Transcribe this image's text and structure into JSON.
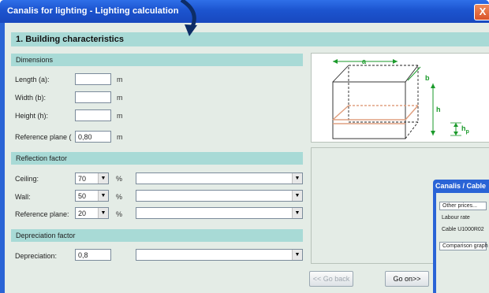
{
  "window": {
    "title": "Canalis for lighting - Lighting calculation",
    "close_label": "X"
  },
  "section": {
    "title": "1. Building characteristics"
  },
  "dimensions": {
    "header": "Dimensions",
    "length_label": "Length (a):",
    "length_value": "",
    "length_unit": "m",
    "width_label": "Width (b):",
    "width_value": "",
    "width_unit": "m",
    "height_label": "Height (h):",
    "height_value": "",
    "height_unit": "m",
    "refplane_label": "Reference plane (",
    "refplane_value": "0,80",
    "refplane_unit": "m"
  },
  "reflection": {
    "header": "Reflection factor",
    "ceiling_label": "Ceiling:",
    "ceiling_value": "70",
    "ceiling_unit": "%",
    "ceiling_desc": "",
    "wall_label": "Wall:",
    "wall_value": "50",
    "wall_unit": "%",
    "wall_desc": "",
    "ref_label": "Reference plane:",
    "ref_value": "20",
    "ref_unit": "%",
    "ref_desc": ""
  },
  "depreciation": {
    "header": "Depreciation factor",
    "label": "Depreciation:",
    "value": "0,8",
    "desc": ""
  },
  "diagram": {
    "a": "a",
    "b": "b",
    "h": "h",
    "hp": "h",
    "hp_sub": "p"
  },
  "buttons": {
    "back": "<< Go back",
    "next": "Go on>>"
  },
  "second_window": {
    "title": "Canalis / Cable",
    "items": [
      "Other prices...",
      "Labour rate",
      "Cable U1000R02",
      "Comparison graph"
    ]
  },
  "colors": {
    "titlebar": "#1c54cf",
    "section": "#a8dad6",
    "client": "#e4ece6",
    "diagram_green": "#1a9a2a",
    "plane": "#e0a080"
  }
}
